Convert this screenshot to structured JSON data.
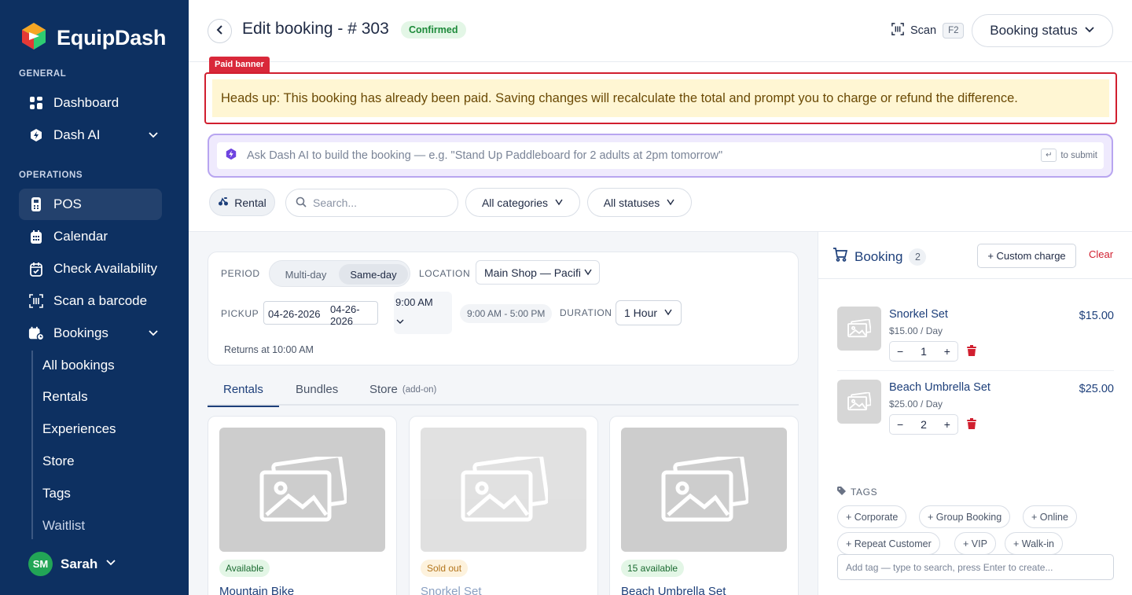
{
  "sidebar": {
    "brand": "EquipDash",
    "section_general": "GENERAL",
    "section_operations": "OPERATIONS",
    "items": {
      "dashboard": "Dashboard",
      "dash_ai": "Dash AI",
      "pos": "POS",
      "calendar": "Calendar",
      "check_availability": "Check Availability",
      "scan_barcode": "Scan a barcode",
      "bookings": "Bookings"
    },
    "bookings_sub": [
      "All bookings",
      "Rentals",
      "Experiences",
      "Store",
      "Tags",
      "Waitlist"
    ],
    "user": {
      "initials": "SM",
      "name": "Sarah"
    },
    "active_item": "POS"
  },
  "header": {
    "title": "Edit booking - # 303",
    "status": "Confirmed",
    "scan_label": "Scan",
    "scan_key": "F2",
    "booking_status_label": "Booking status"
  },
  "banner": {
    "tag": "Paid banner",
    "message": "Heads up: This booking has already been paid. Saving changes will recalculate the total and prompt you to charge or refund the difference."
  },
  "ai": {
    "placeholder": "Ask Dash AI to build the booking — e.g. \"Stand Up Paddleboard for 2 adults at 2pm tomorrow\"",
    "submit_key": "↵",
    "submit_hint": "to submit"
  },
  "filters": {
    "rental_chip": "Rental",
    "search_placeholder": "Search...",
    "categories": "All categories",
    "statuses": "All statuses"
  },
  "period": {
    "period_label": "PERIOD",
    "multi_day": "Multi-day",
    "same_day": "Same-day",
    "selected": "Same-day",
    "location_label": "LOCATION",
    "location_value": "Main Shop — Pacific",
    "pickup_label": "PICKUP",
    "pickup_date_value": "04-26-2026",
    "pickup_date_overlay": "04-26-2026",
    "pickup_time": "9:00 AM",
    "hours": "9:00 AM - 5:00 PM",
    "duration_label": "DURATION",
    "duration_value": "1 Hour",
    "returns": "Returns at 10:00 AM"
  },
  "tabs": {
    "rentals": "Rentals",
    "bundles": "Bundles",
    "store": "Store",
    "store_note": "(add-on)",
    "active": "Rentals"
  },
  "products": [
    {
      "name": "Mountain Bike",
      "badge": "Available",
      "badge_kind": "green"
    },
    {
      "name": "Snorkel Set",
      "badge": "Sold out",
      "badge_kind": "amber"
    },
    {
      "name": "Beach Umbrella Set",
      "badge": "15 available",
      "badge_kind": "green"
    }
  ],
  "booking": {
    "title": "Booking",
    "count": "2",
    "custom_charge": "+ Custom charge",
    "clear": "Clear",
    "items": [
      {
        "name": "Snorkel Set",
        "rate": "$15.00 / Day",
        "qty": "1",
        "price": "$15.00"
      },
      {
        "name": "Beach Umbrella Set",
        "rate": "$25.00 / Day",
        "qty": "2",
        "price": "$25.00"
      }
    ],
    "tags_label": "TAGS",
    "tags": [
      "+ Corporate",
      "+ Group Booking",
      "+ Online",
      "+ Repeat Customer",
      "+ VIP",
      "+ Walk-in"
    ],
    "tag_input_placeholder": "Add tag — type to search, press Enter to create..."
  },
  "colors": {
    "sidebar_bg": "#0d3061",
    "accent_navy": "#1d3f7a",
    "danger": "#d11f2f",
    "success": "#1d8a3a",
    "ai_purple": "#b8a5f0",
    "banner_bg": "#fff6d3"
  }
}
